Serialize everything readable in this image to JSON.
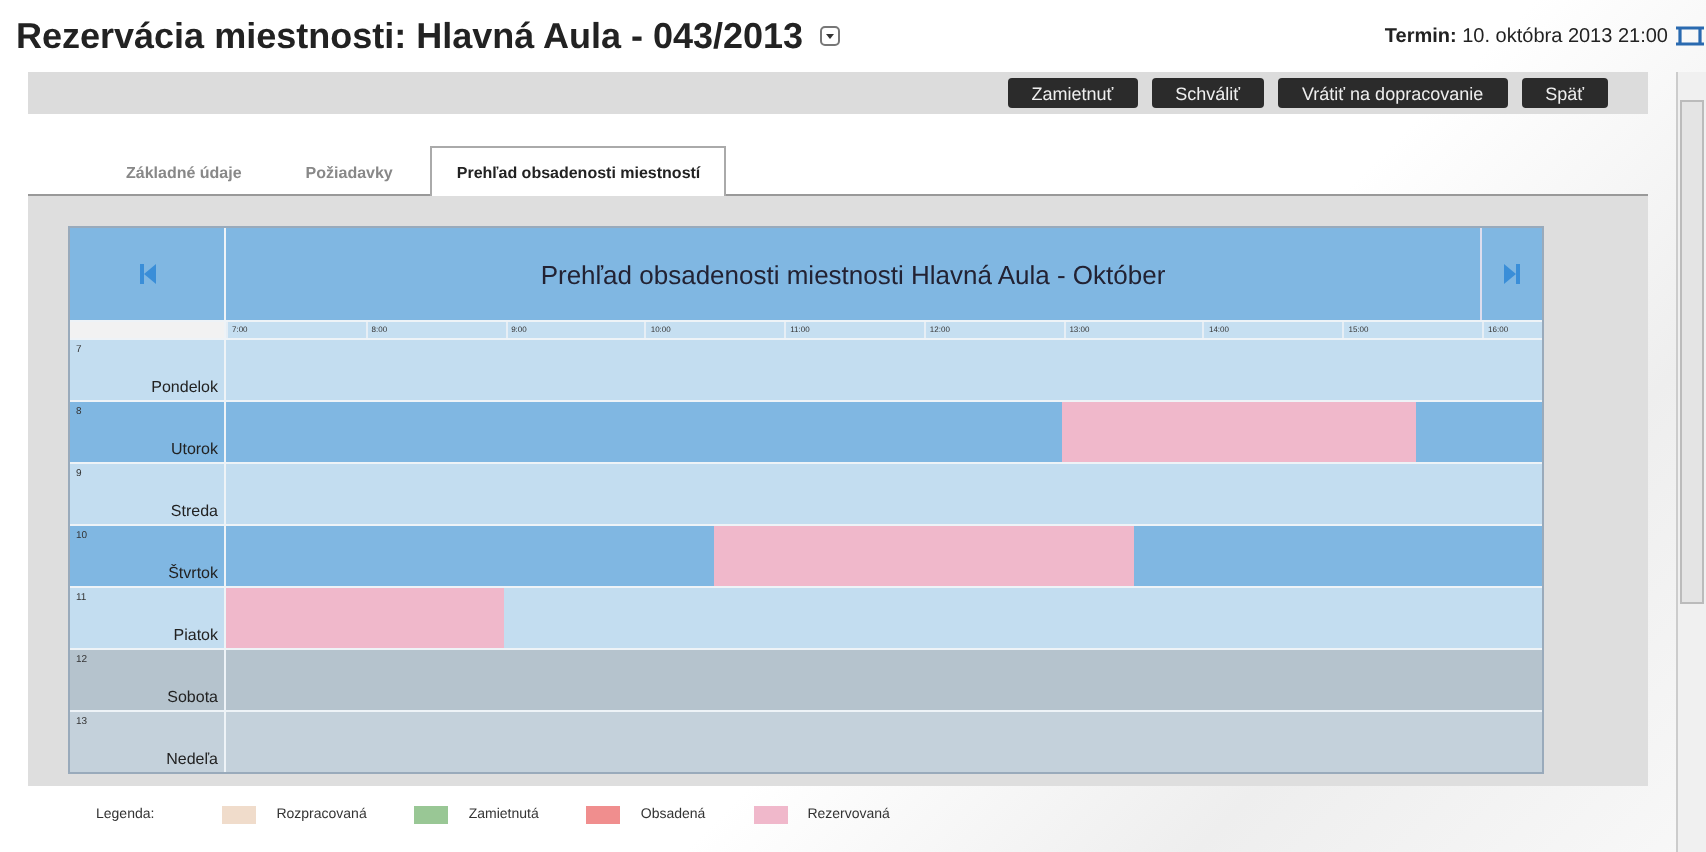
{
  "header": {
    "title": "Rezervácia miestnosti: Hlavná Aula - 043/2013",
    "term_label": "Termin:",
    "term_value": "10. októbra 2013 21:00"
  },
  "actions": [
    "Zamietnuť",
    "Schváliť",
    "Vrátiť na dopracovanie",
    "Späť"
  ],
  "tabs": [
    {
      "label": "Základné údaje",
      "selected": false
    },
    {
      "label": "Požiadavky",
      "selected": false
    },
    {
      "label": "Prehľad obsadenosti miestností",
      "selected": true
    }
  ],
  "calendar": {
    "title": "Prehľad obsadenosti miestnosti Hlavná Aula - Október",
    "hours": [
      "7:00",
      "8:00",
      "9:00",
      "10:00",
      "11:00",
      "12:00",
      "13:00",
      "14:00",
      "15:00",
      "16:00"
    ],
    "days": [
      {
        "date": "7",
        "name": "Pondelok",
        "kind": "weekday"
      },
      {
        "date": "8",
        "name": "Utorok",
        "kind": "marked",
        "reservations": [
          {
            "kind": "reserved"
          }
        ]
      },
      {
        "date": "9",
        "name": "Streda",
        "kind": "weekday"
      },
      {
        "date": "10",
        "name": "Štvrtok",
        "kind": "marked",
        "reservations": [
          {
            "kind": "reserved"
          }
        ]
      },
      {
        "date": "11",
        "name": "Piatok",
        "kind": "weekday",
        "reservations": [
          {
            "kind": "reserved"
          }
        ]
      },
      {
        "date": "12",
        "name": "Sobota",
        "kind": "weekend"
      },
      {
        "date": "13",
        "name": "Nedeľa",
        "kind": "holiday"
      }
    ]
  },
  "legend": {
    "label": "Legenda:",
    "items": [
      {
        "label": "Rozpracovaná",
        "color": "#f0dccb"
      },
      {
        "label": "Zamietnutá",
        "color": "#99c795"
      },
      {
        "label": "Obsadená",
        "color": "#f08e8e"
      },
      {
        "label": "Rezervovaná",
        "color": "#f0b8cb"
      }
    ]
  }
}
